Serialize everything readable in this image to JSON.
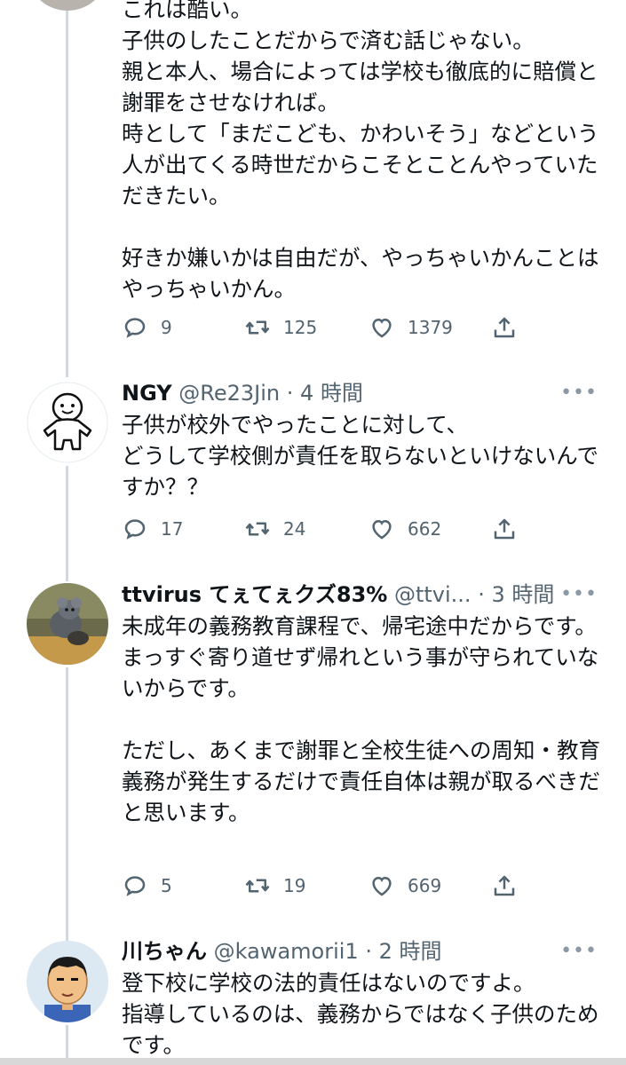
{
  "tweets": [
    {
      "body": "これは酷い。\n子供のしたことだからで済む話じゃない。\n親と本人、場合によっては学校も徹底的に賠償と謝罪をさせなければ。\n時として「まだこども、かわいそう」などという人が出てくる時世だからこそとことんやっていただきたい。\n\n好きか嫌いかは自由だが、やっちゃいかんことはやっちゃいかん。",
      "replies": "9",
      "retweets": "125",
      "likes": "1379"
    },
    {
      "name": "NGY",
      "handle": "@Re23Jin",
      "time": "· 4 時間",
      "body": "子供が校外でやったことに対して、\nどうして学校側が責任を取らないといけないんですか？？",
      "replies": "17",
      "retweets": "24",
      "likes": "662"
    },
    {
      "name": "ttvirus てぇてぇクズ83%",
      "handle": "@ttvi...",
      "time": "· 3 時間",
      "body": "未成年の義務教育課程で、帰宅途中だからです。\nまっすぐ寄り道せず帰れという事が守られていないからです。\n\nただし、あくまで謝罪と全校生徒への周知・教育義務が発生するだけで責任自体は親が取るべきだと思います。",
      "replies": "5",
      "retweets": "19",
      "likes": "669"
    },
    {
      "name": "川ちゃん",
      "handle": "@kawamorii1",
      "time": "· 2 時間",
      "body": "登下校に学校の法的責任はないのですよ。\n指導しているのは、義務からではなく子供のためです。"
    }
  ],
  "more_label": "•••",
  "icons": {
    "reply": "reply-icon",
    "retweet": "retweet-icon",
    "like": "heart-icon",
    "share": "share-icon"
  },
  "colors": {
    "text": "#0f1419",
    "secondary": "#536471",
    "thread_line": "#cfd9de"
  }
}
